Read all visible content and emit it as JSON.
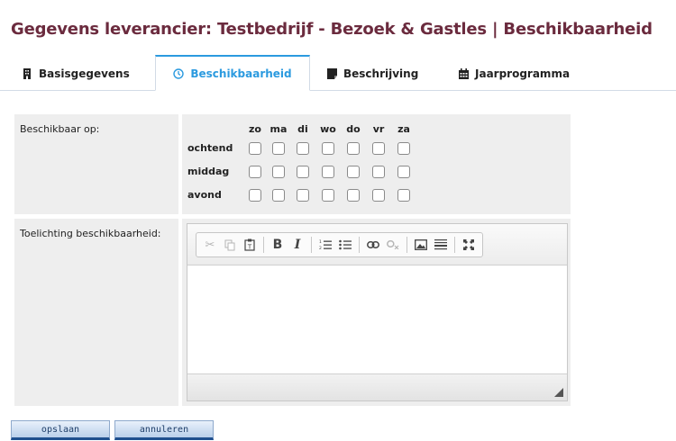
{
  "page": {
    "title": "Gegevens leverancier: Testbedrijf - Bezoek & Gastles | Beschikbaarheid"
  },
  "tabs": [
    {
      "label": "Basisgegevens",
      "icon": "building-icon",
      "active": false
    },
    {
      "label": "Beschikbaarheid",
      "icon": "clock-icon",
      "active": true
    },
    {
      "label": "Beschrijving",
      "icon": "document-icon",
      "active": false
    },
    {
      "label": "Jaarprogramma",
      "icon": "calendar-icon",
      "active": false
    }
  ],
  "availability": {
    "label": "Beschikbaar op:",
    "days": [
      "zo",
      "ma",
      "di",
      "wo",
      "do",
      "vr",
      "za"
    ],
    "periods": [
      "ochtend",
      "middag",
      "avond"
    ]
  },
  "explanation": {
    "label": "Toelichting beschikbaarheid:",
    "value": ""
  },
  "editor_toolbar": [
    "cut-icon",
    "copy-icon",
    "paste-text-icon",
    "bold-icon",
    "italic-icon",
    "numbered-list-icon",
    "bullet-list-icon",
    "link-icon",
    "unlink-icon",
    "image-icon",
    "horizontal-rule-icon",
    "maximize-icon"
  ],
  "actions": {
    "save_label": "opslaan",
    "cancel_label": "annuleren"
  },
  "colors": {
    "title": "#6b2b3e",
    "active_tab": "#2b9adf",
    "panel_bg": "#eeeeee",
    "button_border": "#1f4f8e"
  }
}
